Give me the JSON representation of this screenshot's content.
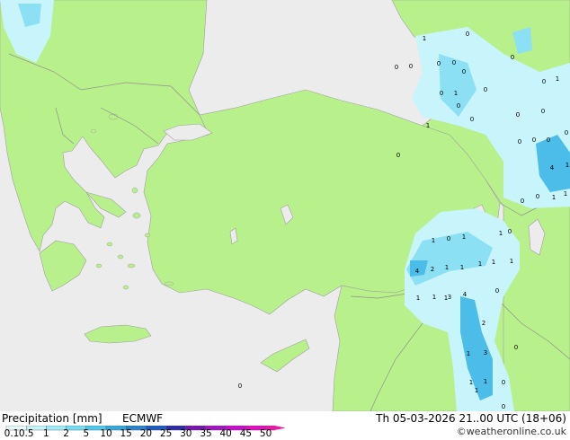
{
  "legend": {
    "title": "Precipitation [mm]",
    "model": "ECMWF",
    "ticks": [
      "0.1",
      "0.5",
      "1",
      "2",
      "5",
      "10",
      "15",
      "20",
      "25",
      "30",
      "35",
      "40",
      "45",
      "50"
    ],
    "colors": [
      "#e8fcff",
      "#c4f4fc",
      "#9cecf8",
      "#74dcf4",
      "#4cc8ec",
      "#34a8dc",
      "#2684d0",
      "#1c5cc0",
      "#2c2ca8",
      "#7c14b0",
      "#a414c4",
      "#c80cd0",
      "#e40cc0",
      "#f014a8"
    ]
  },
  "valid_time": "Th 05-03-2026 21..00 UTC (18+06)",
  "credit": "©weatheronline.co.uk",
  "colors": {
    "land": "#b8f08c",
    "sea": "#ececec",
    "border": "#909090",
    "light_precip": "#c8f4fc",
    "moderate_precip": "#8ce0f4",
    "heavy_precip": "#4cbce8"
  },
  "map_labels": [
    "1",
    "0",
    "0",
    "0",
    "0",
    "0",
    "0",
    "1",
    "0",
    "0",
    "0",
    "1",
    "0",
    "0",
    "0",
    "0",
    "0",
    "0",
    "0",
    "1",
    "0",
    "0",
    "0",
    "1",
    "1",
    "0",
    "1",
    "0",
    "1",
    "4",
    "2",
    "1",
    "1",
    "1",
    "1",
    "1",
    "1",
    "1",
    "3",
    "4",
    "0",
    "2",
    "3",
    "1",
    "1",
    "1",
    "0",
    "0",
    "4",
    "1",
    "1",
    "1",
    "0",
    "1",
    "0",
    "0",
    "0"
  ]
}
